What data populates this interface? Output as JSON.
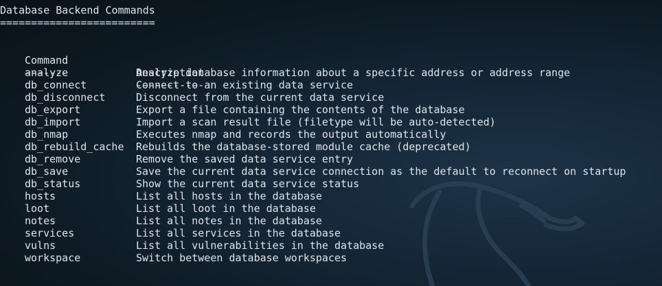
{
  "title": "Database Backend Commands",
  "title_underline": "=========================",
  "header": {
    "command": "Command",
    "description": "Description",
    "command_rule": "-------",
    "description_rule": "-----------"
  },
  "commands": [
    {
      "name": "analyze",
      "description": "Analyze database information about a specific address or address range"
    },
    {
      "name": "db_connect",
      "description": "Connect to an existing data service"
    },
    {
      "name": "db_disconnect",
      "description": "Disconnect from the current data service"
    },
    {
      "name": "db_export",
      "description": "Export a file containing the contents of the database"
    },
    {
      "name": "db_import",
      "description": "Import a scan result file (filetype will be auto-detected)"
    },
    {
      "name": "db_nmap",
      "description": "Executes nmap and records the output automatically"
    },
    {
      "name": "db_rebuild_cache",
      "description": "Rebuilds the database-stored module cache (deprecated)"
    },
    {
      "name": "db_remove",
      "description": "Remove the saved data service entry"
    },
    {
      "name": "db_save",
      "description": "Save the current data service connection as the default to reconnect on startup"
    },
    {
      "name": "db_status",
      "description": "Show the current data service status"
    },
    {
      "name": "hosts",
      "description": "List all hosts in the database"
    },
    {
      "name": "loot",
      "description": "List all loot in the database"
    },
    {
      "name": "notes",
      "description": "List all notes in the database"
    },
    {
      "name": "services",
      "description": "List all services in the database"
    },
    {
      "name": "vulns",
      "description": "List all vulnerabilities in the database"
    },
    {
      "name": "workspace",
      "description": "Switch between database workspaces"
    }
  ],
  "colors": {
    "background": "#0d1720",
    "text": "#dfe5ea",
    "watermark": "#2b4256"
  },
  "icons": {
    "watermark": "kali-dragon-watermark"
  }
}
